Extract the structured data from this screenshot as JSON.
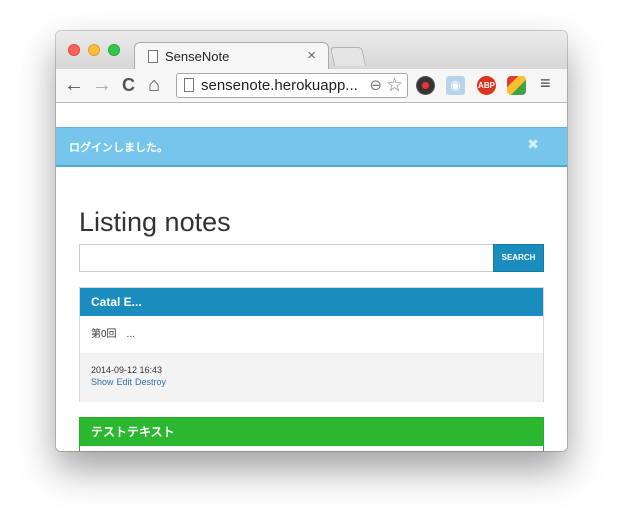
{
  "browser": {
    "tab_title": "SenseNote",
    "tab_close": "×",
    "url": "sensenote.herokuapp...",
    "icons": {
      "back": "←",
      "forward": "→",
      "reload": "C",
      "home": "⌂",
      "zoom": "🔍",
      "star": "☆",
      "menu": "≡"
    },
    "extensions": {
      "camera": "📷",
      "adblock": "ABP"
    }
  },
  "alert": {
    "message": "ログインしました。",
    "close": "✖"
  },
  "main": {
    "title": "Listing notes",
    "search": {
      "placeholder": "",
      "button_label": "SEARCH"
    }
  },
  "notes": [
    {
      "title": "Catal E...",
      "body": "第0回　...",
      "date": "2014-09-12 16:43",
      "links": [
        "Show",
        "Edit",
        "Destroy"
      ],
      "header_color": "#1a8cbd"
    },
    {
      "title": "テストテキスト",
      "header_color": "#2bb72f"
    }
  ],
  "colors": {
    "alert_bg": "#75c6ea",
    "accent_blue": "#1a8cbd",
    "accent_green": "#2bb72f",
    "link": "#2a6fae"
  }
}
